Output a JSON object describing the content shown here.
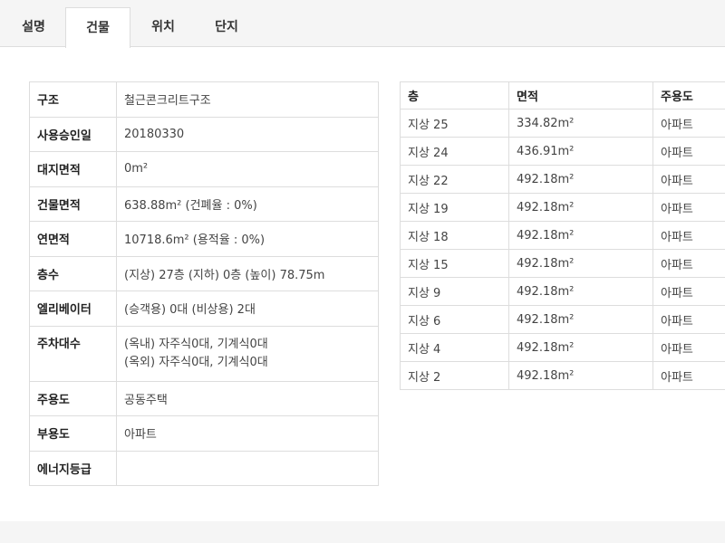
{
  "tabs": [
    {
      "label": "설명",
      "active": false
    },
    {
      "label": "건물",
      "active": true
    },
    {
      "label": "위치",
      "active": false
    },
    {
      "label": "단지",
      "active": false
    }
  ],
  "building": {
    "structure": {
      "label": "구조",
      "value": "철근콘크리트구조"
    },
    "approval_date": {
      "label": "사용승인일",
      "value": "20180330"
    },
    "site_area": {
      "label": "대지면적",
      "value": "0m²"
    },
    "building_area": {
      "label": "건물면적",
      "value": "638.88m² (건폐율 : 0%)"
    },
    "total_floor_area": {
      "label": "연면적",
      "value": "10718.6m² (용적율 : 0%)"
    },
    "floors": {
      "label": "층수",
      "value": "(지상) 27층 (지하) 0층 (높이) 78.75m"
    },
    "elevators": {
      "label": "엘리베이터",
      "value": "(승객용) 0대 (비상용) 2대"
    },
    "parking": {
      "label": "주차대수",
      "indoor": "(옥내) 자주식0대, 기계식0대",
      "outdoor": "(옥외) 자주식0대, 기계식0대"
    },
    "main_use": {
      "label": "주용도",
      "value": "공동주택"
    },
    "sub_use": {
      "label": "부용도",
      "value": "아파트"
    },
    "energy_grade": {
      "label": "에너지등급",
      "value": ""
    }
  },
  "floor_table": {
    "headers": [
      "층",
      "면적",
      "주용도"
    ],
    "rows": [
      [
        "지상 25",
        "334.82m²",
        "아파트"
      ],
      [
        "지상 24",
        "436.91m²",
        "아파트"
      ],
      [
        "지상 22",
        "492.18m²",
        "아파트"
      ],
      [
        "지상 19",
        "492.18m²",
        "아파트"
      ],
      [
        "지상 18",
        "492.18m²",
        "아파트"
      ],
      [
        "지상 15",
        "492.18m²",
        "아파트"
      ],
      [
        "지상 9",
        "492.18m²",
        "아파트"
      ],
      [
        "지상 6",
        "492.18m²",
        "아파트"
      ],
      [
        "지상 4",
        "492.18m²",
        "아파트"
      ],
      [
        "지상 2",
        "492.18m²",
        "아파트"
      ]
    ]
  }
}
